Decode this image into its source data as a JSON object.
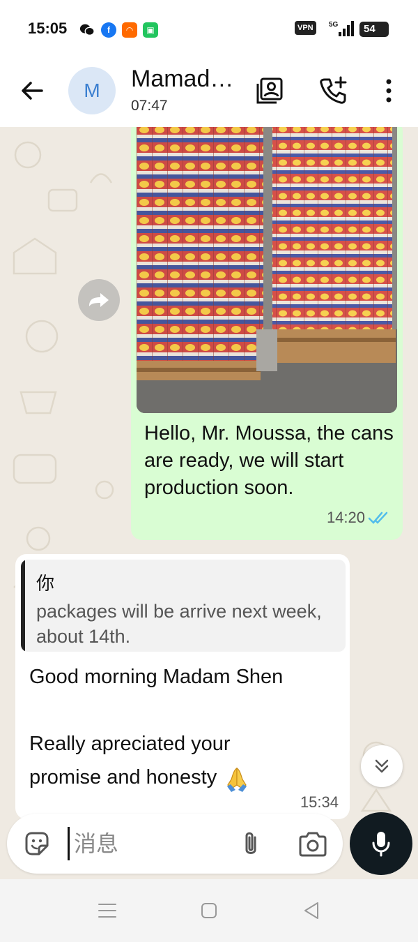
{
  "status_bar": {
    "time": "15:05",
    "apps": [
      "wechat-icon",
      "facebook-icon",
      "alibaba-1688-icon",
      "dingtalk-icon"
    ],
    "vpn_label": "VPN",
    "network_label": "5G",
    "battery_level": "54"
  },
  "header": {
    "avatar_letter": "M",
    "contact_name": "Mamad…",
    "contact_status": "07:47",
    "icons": [
      "back-arrow-icon",
      "contact-card-icon",
      "add-call-icon",
      "more-vertical-icon"
    ]
  },
  "messages": {
    "outgoing": {
      "image": "photo-of-stacked-cans-on-pallets",
      "text": "Hello, Mr. Moussa, the cans are ready, we will start production soon.",
      "time": "14:20",
      "status": "read"
    },
    "incoming": {
      "quote_author": "你",
      "quote_text": "packages will be arrive  next week, about 14th.",
      "text": "Good morning Madam Shen\n\nReally apreciated your\npromise and honesty",
      "emoji": "folded-hands-emoji",
      "time": "15:34"
    }
  },
  "composer": {
    "placeholder": "消息"
  },
  "colors": {
    "chat_background": "#efeae2",
    "outgoing_bubble": "#d9fdd3",
    "incoming_bubble": "#ffffff",
    "read_ticks": "#53bdeb",
    "avatar_bg": "#dbe7f6",
    "mic_button": "#111b21"
  }
}
